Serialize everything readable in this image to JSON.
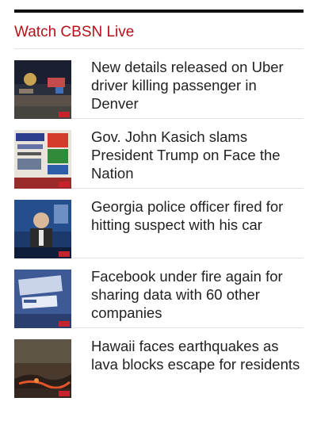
{
  "header": {
    "title": "Watch CBSN Live"
  },
  "stories": [
    {
      "headline": "New details released on Uber driver killing passenger in Denver",
      "thumb_icon": "night-crime-scene-thumbnail"
    },
    {
      "headline": "Gov. John Kasich slams President Trump on Face the Nation",
      "thumb_icon": "newspaper-collage-thumbnail"
    },
    {
      "headline": "Georgia police officer fired for hitting suspect with his car",
      "thumb_icon": "news-anchor-thumbnail"
    },
    {
      "headline": "Facebook under fire again for sharing data with 60 other companies",
      "thumb_icon": "facebook-screen-thumbnail"
    },
    {
      "headline": "Hawaii faces earthquakes as lava blocks escape for residents",
      "thumb_icon": "lava-flow-thumbnail"
    }
  ],
  "colors": {
    "accent": "#b4121b",
    "text": "#222222",
    "divider": "#e2e2e2"
  }
}
